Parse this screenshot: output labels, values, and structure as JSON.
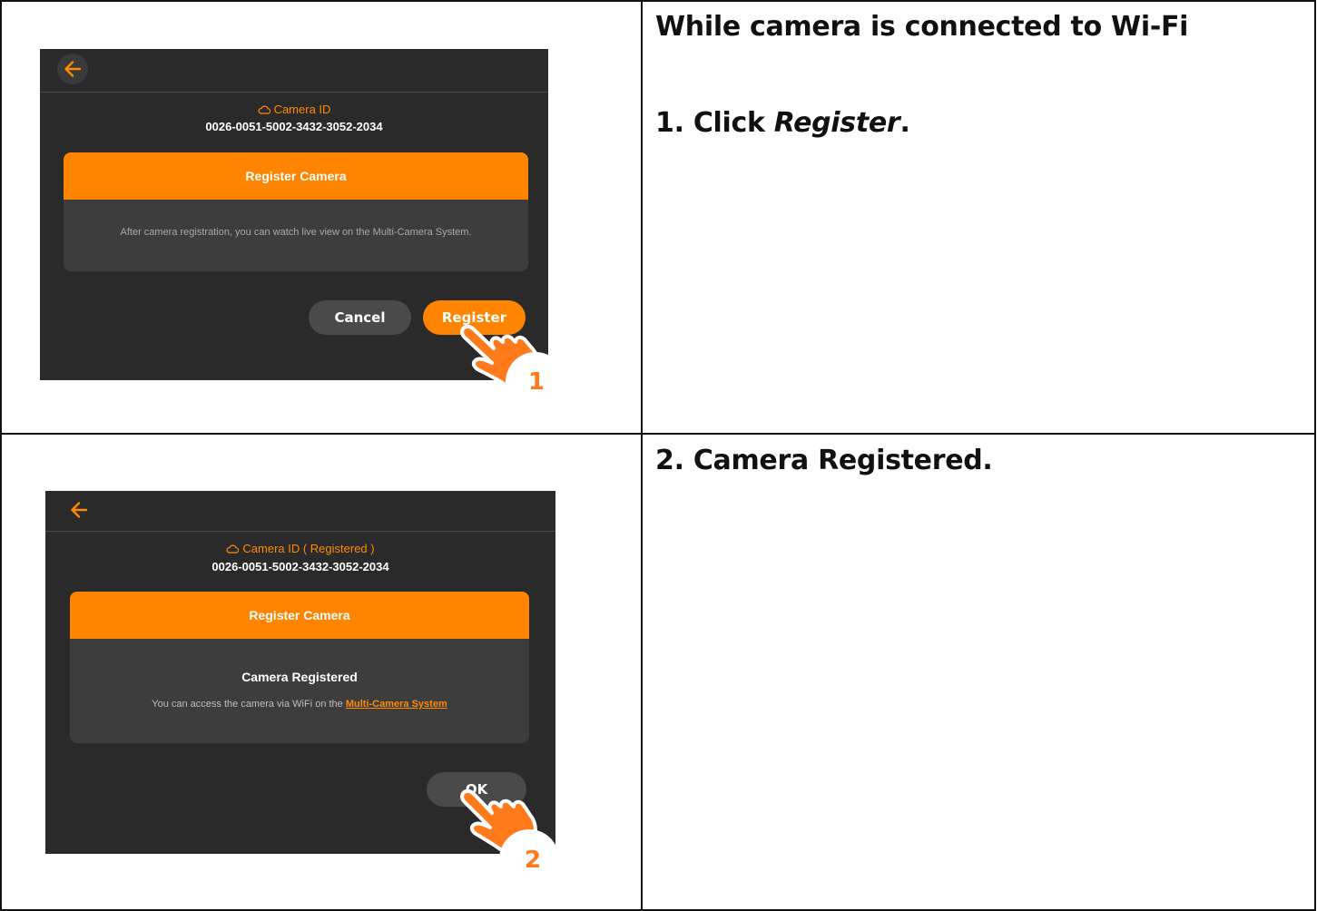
{
  "steps": [
    {
      "heading": "While camera is connected to Wi-Fi",
      "instruction_prefix": "1.  Click ",
      "instruction_em": "Register",
      "instruction_suffix": ".",
      "screen": {
        "camera_id_label": "Camera ID",
        "camera_id": "0026-0051-5002-3432-3052-2034",
        "dialog_title": "Register Camera",
        "dialog_message": "After camera registration, you can watch live view on the Multi-Camera System.",
        "cancel_label": "Cancel",
        "register_label": "Register"
      },
      "callout_number": "1"
    },
    {
      "instruction": "2.  Camera Registered.",
      "screen": {
        "camera_id_label": "Camera ID ( Registered )",
        "camera_id": "0026-0051-5002-3432-3052-2034",
        "dialog_title": "Register Camera",
        "result_title": "Camera Registered",
        "result_message_prefix": "You can access the camera via WiFi on the ",
        "result_link": "Multi-Camera System",
        "ok_label": "OK"
      },
      "callout_number": "2"
    }
  ],
  "colors": {
    "accent": "#ff8400",
    "screen_bg": "#2a2a2a",
    "dialog_bg": "#3d3d3d",
    "button_dark": "#4a4a4a",
    "callout": "#ff7a1a"
  },
  "icons": [
    "back-arrow-icon",
    "cloud-icon",
    "pointing-hand-icon"
  ]
}
